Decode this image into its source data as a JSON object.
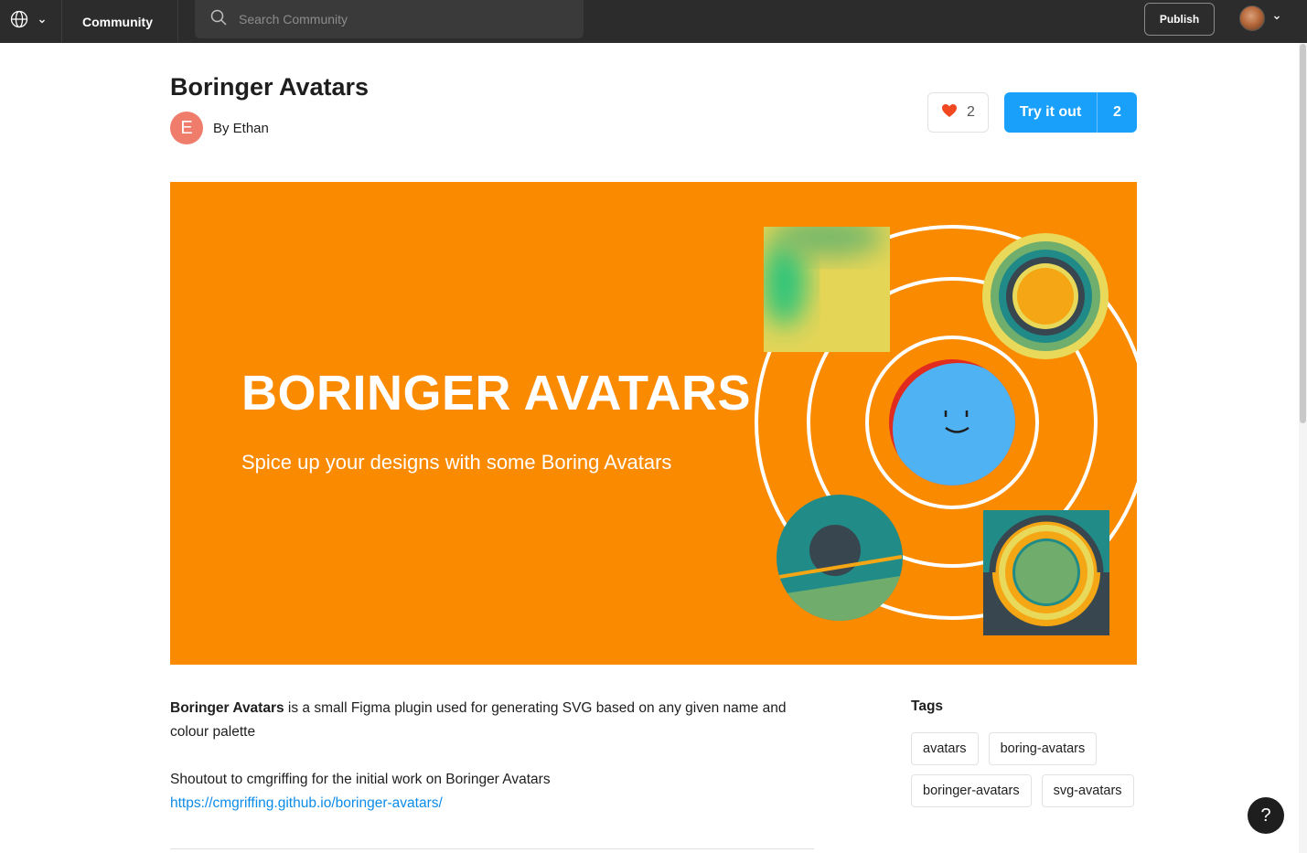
{
  "topbar": {
    "community_label": "Community",
    "search_placeholder": "Search Community",
    "publish_label": "Publish"
  },
  "plugin": {
    "title": "Boringer Avatars",
    "author_initial": "E",
    "author_label": "By Ethan",
    "like_count": "2",
    "try_label": "Try it out",
    "try_count": "2"
  },
  "banner": {
    "title": "BORINGER AVATARS",
    "subtitle": "Spice up your designs with some Boring Avatars",
    "background_color": "#fa8a00"
  },
  "description": {
    "bold_name": "Boringer Avatars",
    "intro_rest": " is a small Figma plugin used for generating SVG based on any given name and colour palette",
    "shoutout": "Shoutout to cmgriffing for the initial work on Boringer Avatars",
    "link": "https://cmgriffing.github.io/boringer-avatars/"
  },
  "tags": {
    "title": "Tags",
    "items": [
      "avatars",
      "boring-avatars",
      "boringer-avatars",
      "svg-avatars"
    ]
  },
  "help_label": "?",
  "colors": {
    "topbar": "#2c2c2c",
    "accent": "#18a0fb",
    "link": "#0c8ce9",
    "author_avatar": "#f07c6c"
  }
}
